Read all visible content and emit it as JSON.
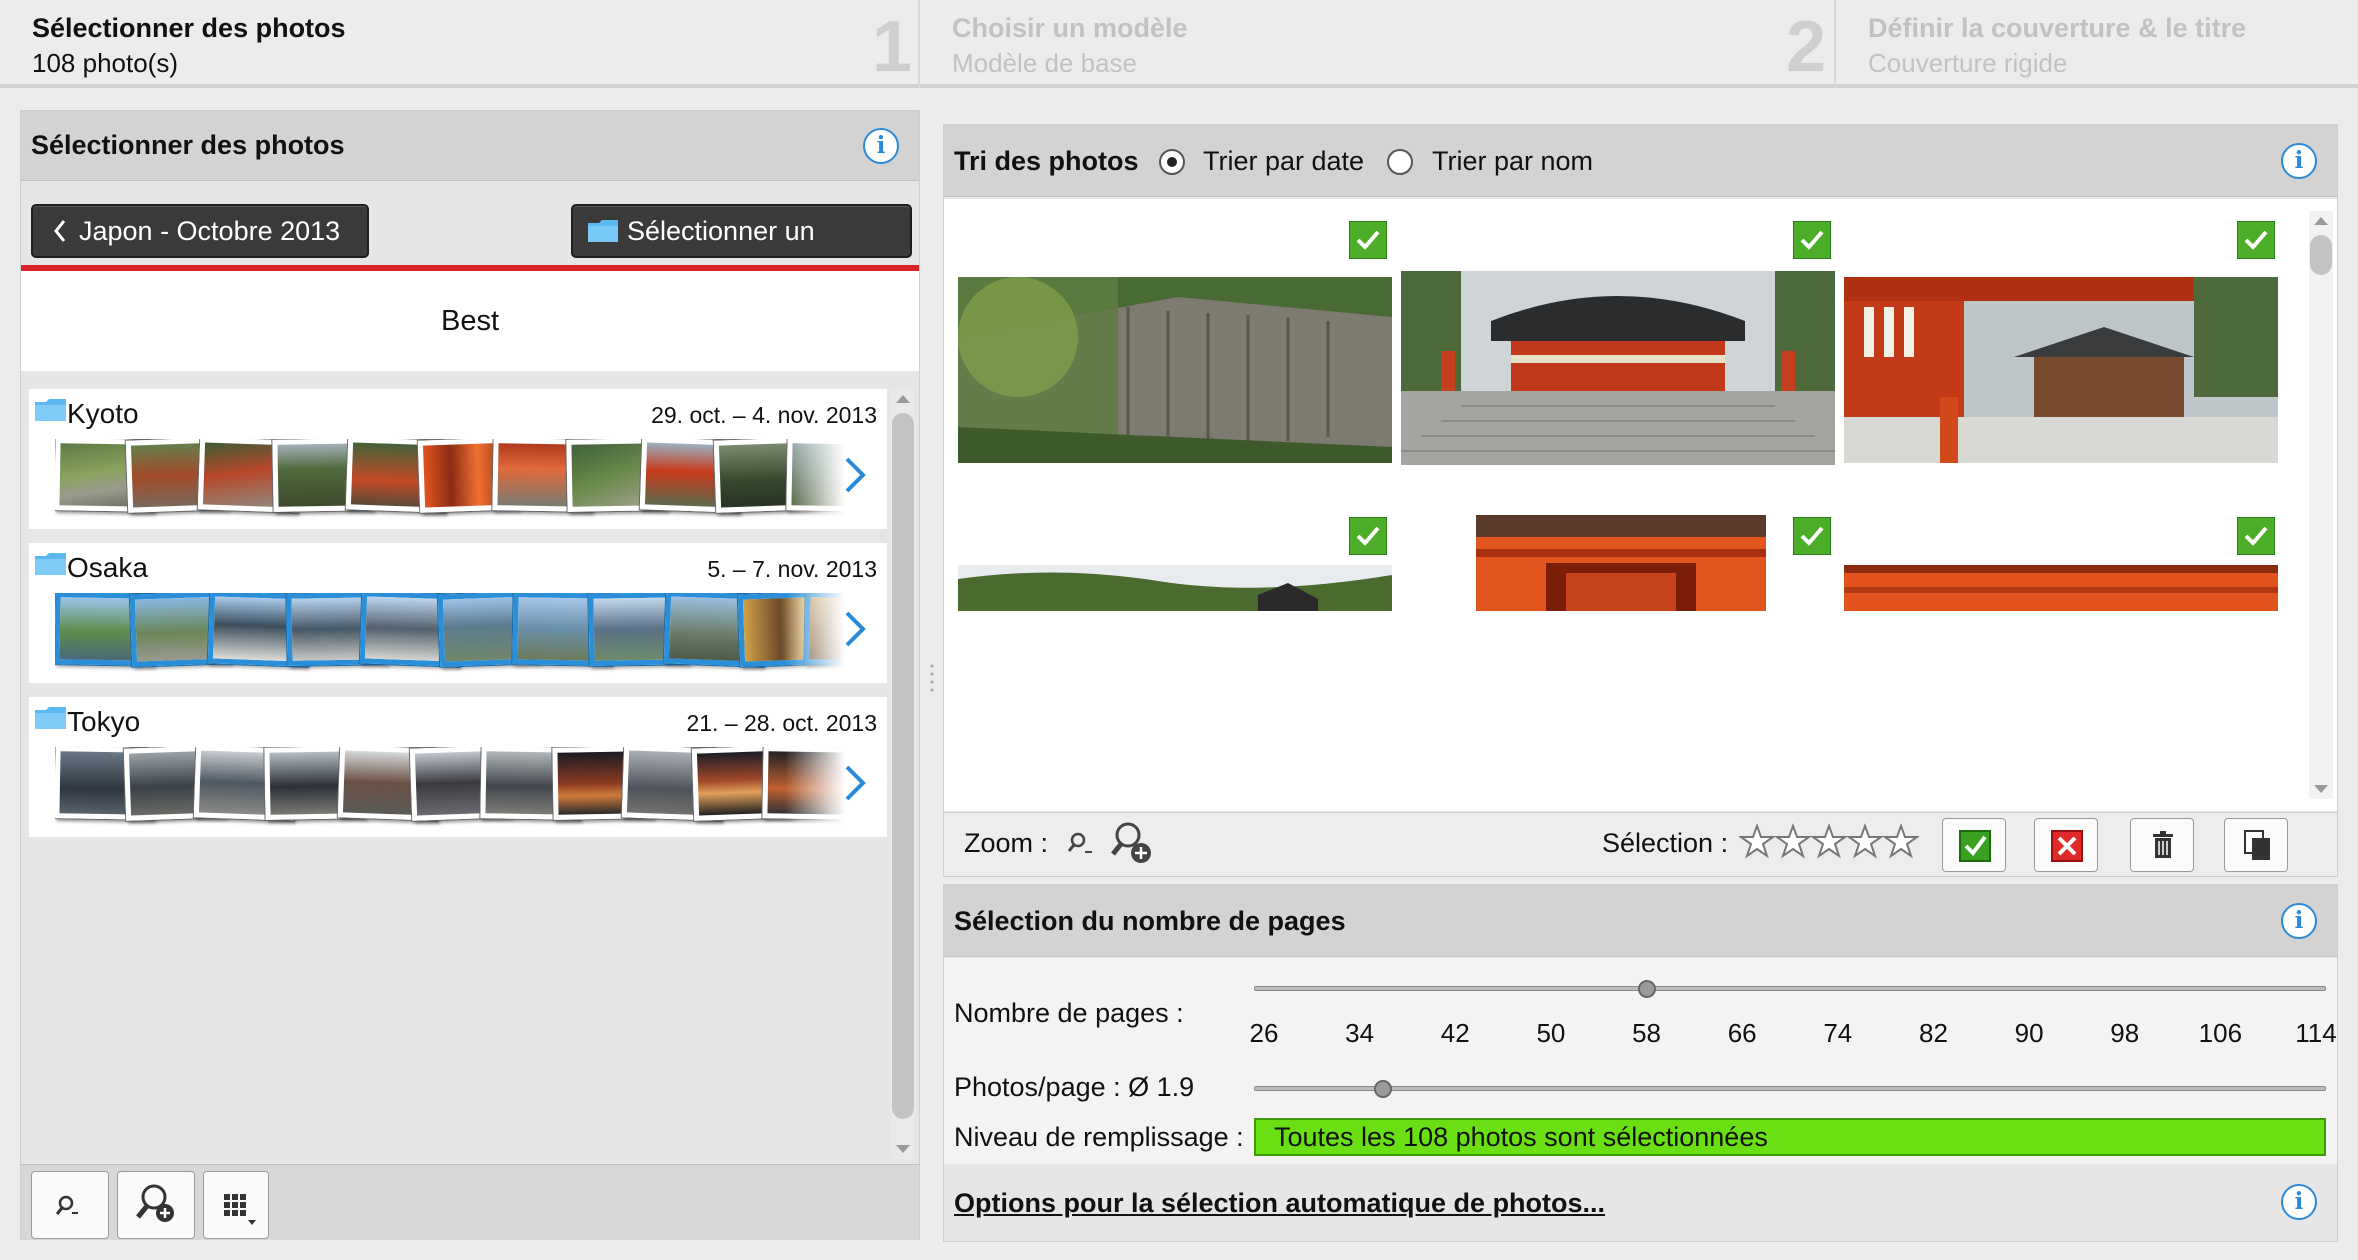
{
  "steps": [
    {
      "title": "Sélectionner des photos",
      "subtitle": "108 photo(s)",
      "number": "1"
    },
    {
      "title": "Choisir un modèle",
      "subtitle": "Modèle de base",
      "number": "2"
    },
    {
      "title": "Définir la couverture & le titre",
      "subtitle": "Couverture rigide"
    }
  ],
  "left_panel": {
    "title": "Sélectionner des photos",
    "back_button": "Japon - Octobre 2013",
    "select_file_button": "Sélectionner un fichier",
    "section_label": "Best",
    "albums": [
      {
        "name": "Kyoto",
        "dates": "29. oct. – 4. nov. 2013"
      },
      {
        "name": "Osaka",
        "dates": "5. – 7. nov. 2013"
      },
      {
        "name": "Tokyo",
        "dates": "21. – 28. oct. 2013"
      }
    ]
  },
  "right_panel": {
    "sort_title": "Tri des photos",
    "sort_by_date": "Trier par date",
    "sort_by_name": "Trier par nom",
    "zoom_label": "Zoom :",
    "selection_label": "Sélection :"
  },
  "pages_panel": {
    "title": "Sélection du nombre de pages",
    "pages_label": "Nombre de pages :",
    "ticks": [
      "26",
      "34",
      "42",
      "50",
      "58",
      "66",
      "74",
      "82",
      "90",
      "98",
      "106",
      "114"
    ],
    "pages_value": 58,
    "photos_label": "Photos/page :  Ø 1.9",
    "fill_label": "Niveau de remplissage :",
    "fill_status": "Toutes les 108 photos sont sélectionnées",
    "fill_level": 1.0,
    "auto_link": "Options pour la sélection automatique de photos..."
  },
  "colors": {
    "accent": "#2a8ad8",
    "check": "#4cae28",
    "fill": "#6adf14",
    "red_line": "#d9252a"
  }
}
